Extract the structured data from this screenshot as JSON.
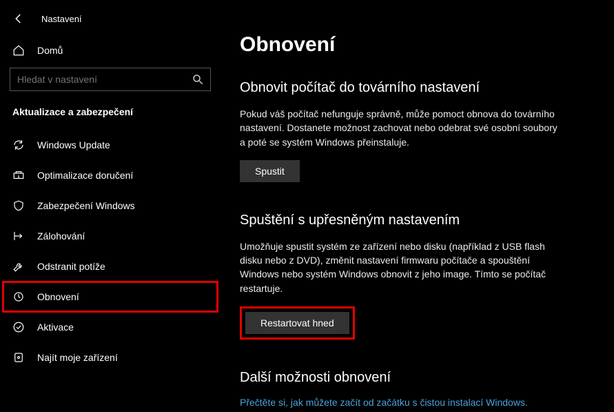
{
  "titlebar": {
    "app_title": "Nastavení"
  },
  "home": {
    "label": "Domů"
  },
  "search": {
    "placeholder": "Hledat v nastavení"
  },
  "section_label": "Aktualizace a zabezpečení",
  "nav": [
    {
      "label": "Windows Update"
    },
    {
      "label": "Optimalizace doručení"
    },
    {
      "label": "Zabezpečení Windows"
    },
    {
      "label": "Zálohování"
    },
    {
      "label": "Odstranit potíže"
    },
    {
      "label": "Obnovení"
    },
    {
      "label": "Aktivace"
    },
    {
      "label": "Najít moje zařízení"
    }
  ],
  "main": {
    "page_title": "Obnovení",
    "reset": {
      "heading": "Obnovit počítač do továrního nastavení",
      "desc": "Pokud váš počítač nefunguje správně, může pomoct obnova do továrního nastavení. Dostanete možnost zachovat nebo odebrat své osobní soubory a poté se systém Windows přeinstaluje.",
      "button": "Spustit"
    },
    "advanced": {
      "heading": "Spuštění s upřesněným nastavením",
      "desc": "Umožňuje spustit systém ze zařízení nebo disku (například z USB flash disku nebo z DVD), změnit nastavení firmwaru počítače a spouštění Windows nebo systém Windows obnovit z jeho image. Tímto se počítač restartuje.",
      "button": "Restartovat hned"
    },
    "more": {
      "heading": "Další možnosti obnovení",
      "link": "Přečtěte si, jak můžete začít od začátku s čistou instalací Windows."
    }
  }
}
